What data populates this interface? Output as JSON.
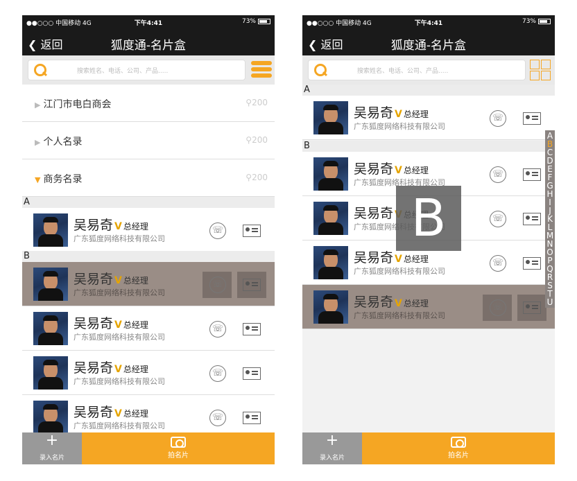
{
  "status": {
    "carrier": "●●○○○ 中国移动  4G",
    "time": "下午4:41",
    "battery": "73%"
  },
  "nav": {
    "back": "返回",
    "title": "狐度通-名片盒"
  },
  "search": {
    "placeholder": "搜索姓名、电话、公司、产品....."
  },
  "groups": [
    {
      "label": "江门市电白商会",
      "count": "200"
    },
    {
      "label": "个人名录",
      "count": "200"
    },
    {
      "label": "商务名录",
      "count": "200"
    }
  ],
  "section_a": "A",
  "section_b": "B",
  "contact": {
    "name": "吴易奇",
    "vip": "V",
    "rank": "总经理",
    "company": "广东狐度网络科技有限公司"
  },
  "bottom": {
    "add": "录入名片",
    "shoot": "拍名片"
  },
  "index_letters": [
    "A",
    "B",
    "C",
    "D",
    "E",
    "F",
    "G",
    "H",
    "I",
    "J",
    "K",
    "L",
    "M",
    "N",
    "O",
    "P",
    "Q",
    "R",
    "S",
    "T",
    "U"
  ],
  "overlay_letter": "B"
}
